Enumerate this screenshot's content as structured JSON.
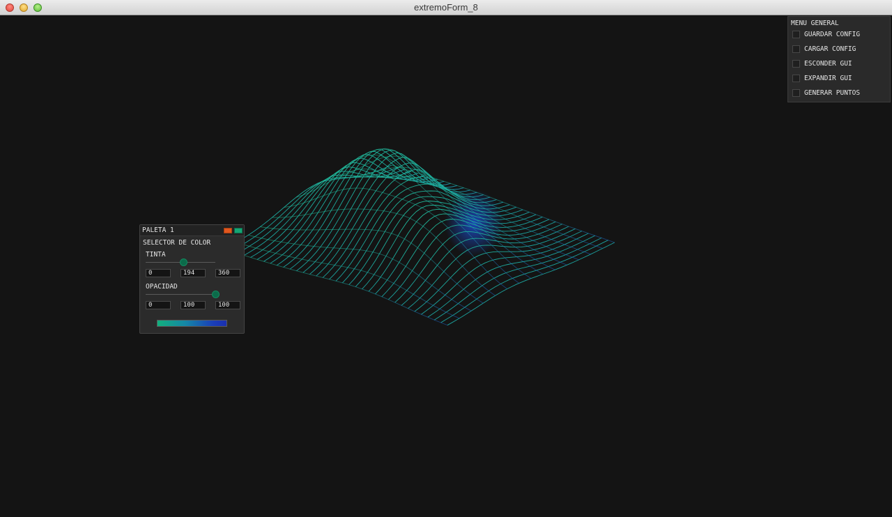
{
  "window": {
    "title": "extremoForm_8"
  },
  "menu": {
    "title": "MENU GENERAL",
    "items": [
      {
        "label": "GUARDAR CONFIG"
      },
      {
        "label": "CARGAR CONFIG"
      },
      {
        "label": "ESCONDER GUI"
      },
      {
        "label": "EXPANDIR GUI"
      },
      {
        "label": "GENERAR PUNTOS"
      }
    ]
  },
  "palette": {
    "title": "PALETA 1",
    "selector_label": "SELECTOR DE COLOR",
    "tint": {
      "label": "TINTA",
      "min": "0",
      "value": "194",
      "max": "360"
    },
    "opacity": {
      "label": "OPACIDAD",
      "min": "0",
      "value": "100",
      "max": "100"
    },
    "gradient_colors": [
      "#12b07d",
      "#1588a6",
      "#1a3fb8"
    ]
  },
  "colors": {
    "background": "#141414",
    "mesh_start": "#1fb88a",
    "mesh_end": "#1a55c8",
    "panel": "#2a2a2a"
  }
}
